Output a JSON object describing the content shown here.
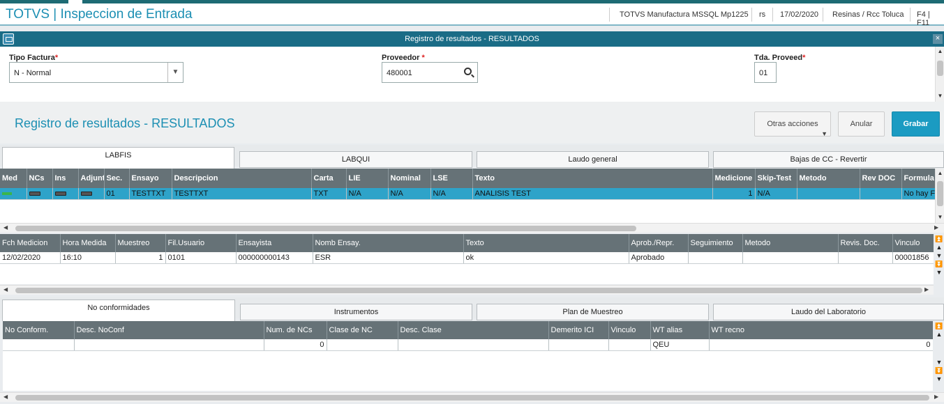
{
  "app": {
    "title": "TOTVS | Inspeccion de Entrada",
    "system": "TOTVS Manufactura MSSQL Mp1225",
    "user": "rs",
    "date": "17/02/2020",
    "company": "Resinas / Rcc Toluca",
    "shortcuts": "F4 | F11"
  },
  "dialog": {
    "title": "Registro de resultados - RESULTADOS",
    "close": "×"
  },
  "form": {
    "tipo_factura_label": "Tipo Factura",
    "tipo_factura_value": "N - Normal",
    "proveedor_label": "Proveedor ",
    "proveedor_value": "480001",
    "tda_label": "Tda. Proveed",
    "tda_value": "01",
    "required_mark": "*"
  },
  "toolbar": {
    "page_title": "Registro de resultados - RESULTADOS",
    "otras_acciones": "Otras acciones",
    "anular": "Anular",
    "grabar": "Grabar"
  },
  "tabs_top": [
    "LABFIS",
    "LABQUI",
    "Laudo general",
    "Bajas de CC - Revertir"
  ],
  "grid1": {
    "headers": [
      "Med",
      "NCs",
      "Ins",
      "Adjunt",
      "Sec.",
      "Ensayo",
      "Descripcion",
      "Carta",
      "LIE",
      "Nominal",
      "LSE",
      "Texto",
      "Medicione",
      "Skip-Test",
      "Metodo",
      "Rev DOC",
      "Formula"
    ],
    "row": {
      "sec": "01",
      "ensayo": "TESTTXT",
      "descripcion": "TESTTXT",
      "carta": "TXT",
      "lie": "N/A",
      "nominal": "N/A",
      "lse": "N/A",
      "texto": "ANALISIS TEST",
      "mediciones": "1",
      "skip": "N/A",
      "metodo": "",
      "revdoc": "",
      "formula": "No hay Fo"
    }
  },
  "grid2": {
    "headers": [
      "Fch Medicion",
      "Hora Medida",
      "Muestreo",
      "Fil.Usuario",
      "Ensayista",
      "Nomb Ensay.",
      "Texto",
      "Aprob./Repr.",
      "Seguimiento",
      "Metodo",
      "Revis. Doc.",
      "Vinculo"
    ],
    "row": [
      "12/02/2020",
      "16:10",
      "1",
      "0101",
      "000000000143",
      "ESR",
      "ok",
      "Aprobado",
      "",
      "",
      "",
      "00001856"
    ]
  },
  "tabs_bottom": [
    "No conformidades",
    "Instrumentos",
    "Plan de Muestreo",
    "Laudo del Laboratorio"
  ],
  "grid3": {
    "headers": [
      "No Conform.",
      "Desc. NoConf",
      "Num. de NCs",
      "Clase de NC",
      "Desc. Clase",
      "Demerito ICI",
      "Vinculo",
      "WT alias",
      "WT recno"
    ],
    "row": [
      "",
      "",
      "0",
      "",
      "",
      "",
      "",
      "QEU",
      "0"
    ]
  },
  "colors": {
    "accent": "#1c8fb3",
    "dialog_bar": "#1a6c86",
    "grid_header": "#667277",
    "selected_row": "#2ea3c9",
    "grabar": "#1b9bc2"
  }
}
